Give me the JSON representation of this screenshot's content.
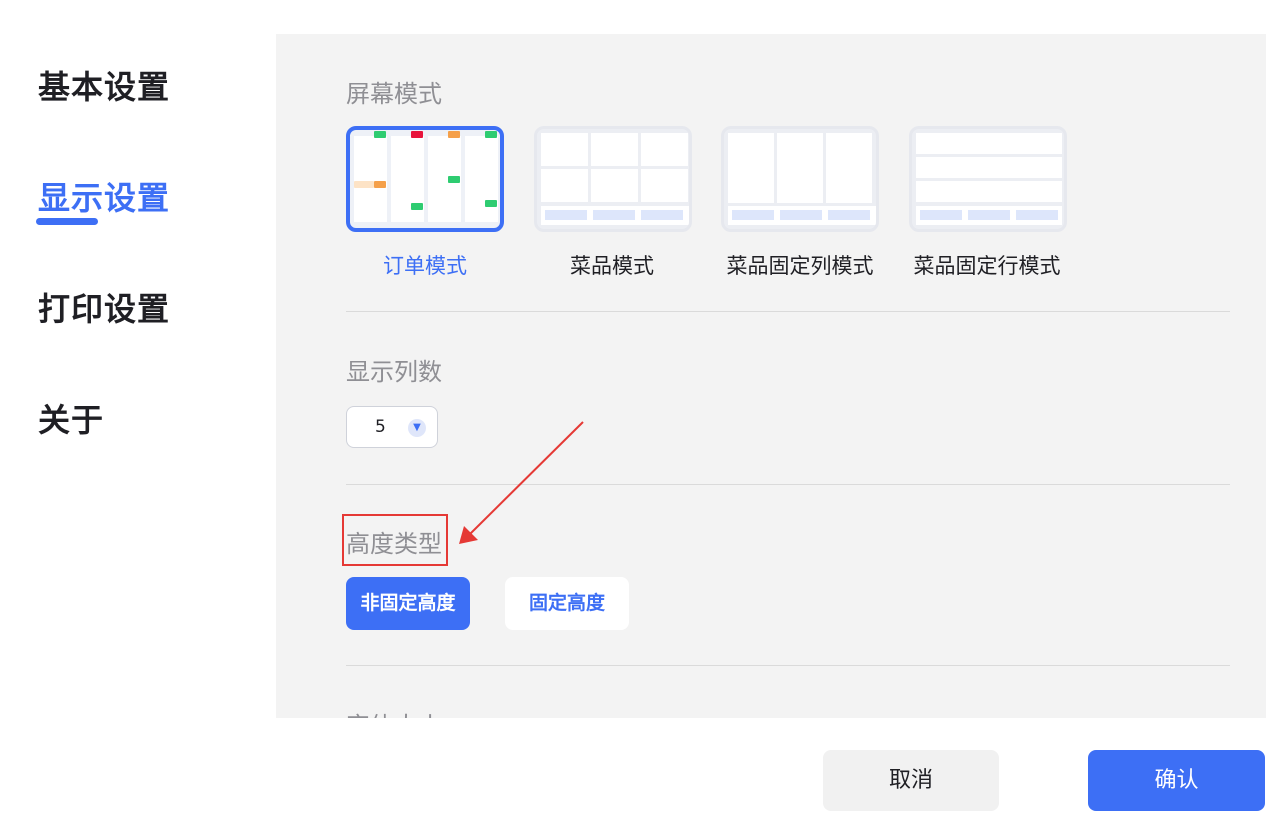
{
  "sidebar": {
    "items": [
      {
        "label": "基本设置",
        "active": false
      },
      {
        "label": "显示设置",
        "active": true
      },
      {
        "label": "打印设置",
        "active": false
      },
      {
        "label": "关于",
        "active": false
      }
    ]
  },
  "screen_mode": {
    "title": "屏幕模式",
    "options": [
      {
        "label": "订单模式",
        "selected": true
      },
      {
        "label": "菜品模式",
        "selected": false
      },
      {
        "label": "菜品固定列模式",
        "selected": false
      },
      {
        "label": "菜品固定行模式",
        "selected": false
      }
    ]
  },
  "columns": {
    "title": "显示列数",
    "value": "5",
    "icon": "chevron-down-icon"
  },
  "height_type": {
    "title": "高度类型",
    "options": [
      {
        "label": "非固定高度",
        "selected": true
      },
      {
        "label": "固定高度",
        "selected": false
      }
    ]
  },
  "font_size": {
    "title": "字体大小"
  },
  "footer": {
    "cancel_label": "取消",
    "confirm_label": "确认"
  },
  "colors": {
    "accent": "#3d6ff5",
    "annotation": "#e53935",
    "tag_green": "#2ecc71",
    "tag_red": "#e8143c",
    "tag_orange": "#f5a04a",
    "tag_light_orange": "#fde3c6"
  }
}
